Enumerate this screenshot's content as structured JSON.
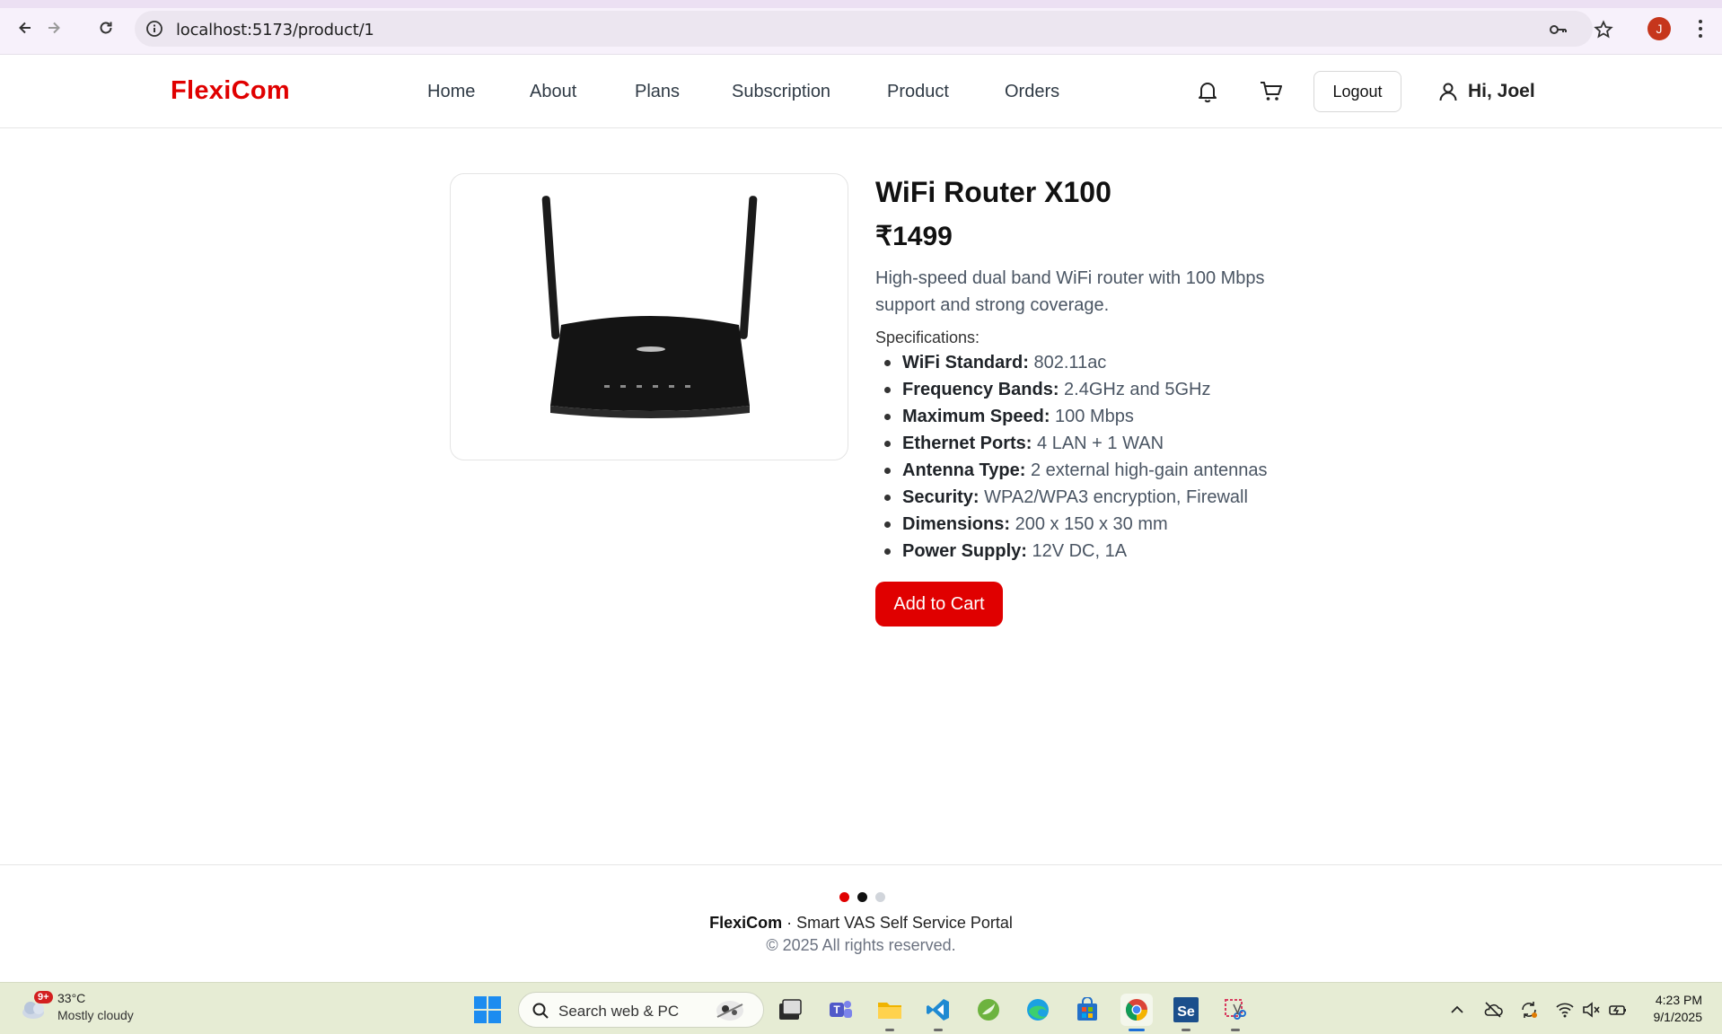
{
  "browser": {
    "url": "localhost:5173/product/1",
    "profile_initial": "J"
  },
  "header": {
    "logo": "FlexiCom",
    "nav": [
      "Home",
      "About",
      "Plans",
      "Subscription",
      "Product",
      "Orders"
    ],
    "logout_label": "Logout",
    "greeting": "Hi, Joel"
  },
  "product": {
    "title": "WiFi Router X100",
    "price": "₹1499",
    "description": "High-speed dual band WiFi router with 100 Mbps support and strong coverage.",
    "spec_heading": "Specifications:",
    "specs": [
      {
        "label": "WiFi Standard:",
        "value": "802.11ac"
      },
      {
        "label": "Frequency Bands:",
        "value": "2.4GHz and 5GHz"
      },
      {
        "label": "Maximum Speed:",
        "value": "100 Mbps"
      },
      {
        "label": "Ethernet Ports:",
        "value": "4 LAN + 1 WAN"
      },
      {
        "label": "Antenna Type:",
        "value": "2 external high-gain antennas"
      },
      {
        "label": "Security:",
        "value": "WPA2/WPA3 encryption, Firewall"
      },
      {
        "label": "Dimensions:",
        "value": "200 x 150 x 30 mm"
      },
      {
        "label": "Power Supply:",
        "value": "12V DC, 1A"
      }
    ],
    "add_to_cart_label": "Add to Cart"
  },
  "footer": {
    "dot_colors": [
      "#e00000",
      "#111111",
      "#d1d5db"
    ],
    "brand": "FlexiCom",
    "tagline": " · Smart VAS Self Service Portal",
    "copyright": "© 2025 All rights reserved."
  },
  "taskbar": {
    "weather_badge": "9+",
    "temperature": "33°C",
    "condition": "Mostly cloudy",
    "search_placeholder": "Search web & PC",
    "time": "4:23 PM",
    "date": "9/1/2025"
  },
  "colors": {
    "brand_red": "#e00000",
    "browser_chrome": "#f7f1fb",
    "taskbar_bg": "#e6ecd4"
  }
}
